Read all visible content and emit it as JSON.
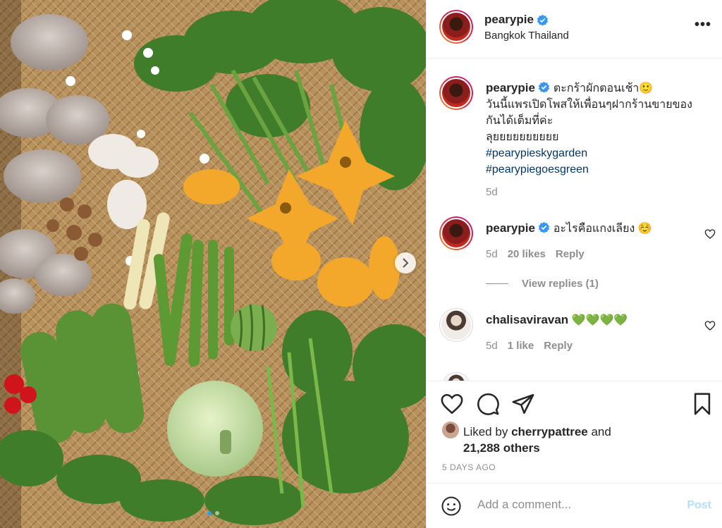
{
  "post": {
    "username": "pearypie",
    "location": "Bangkok Thailand",
    "more_label": "•••"
  },
  "caption": {
    "username": "pearypie",
    "lines": [
      "ตะกร้าผักตอนเช้า🙂",
      "วันนี้แพรเปิดโพสให้เพื่อนๆฝากร้านขายของ",
      "กันได้เต็มที่ค่ะ",
      "ลุยยยยยยยยยย"
    ],
    "hashtags": [
      "#pearypieskygarden",
      "#pearypiegoesgreen"
    ],
    "time": "5d"
  },
  "comments": [
    {
      "username": "pearypie",
      "text": "อะไรคือแกงเลียง ☺️",
      "time": "5d",
      "likes": "20 likes",
      "reply": "Reply",
      "view_replies": "View replies (1)"
    },
    {
      "username": "chalisaviravan",
      "text": "💚💚💚💚",
      "time": "5d",
      "likes": "1 like",
      "reply": "Reply"
    }
  ],
  "likes": {
    "prefix": "Liked by",
    "user": "cherrypattree",
    "and": "and",
    "others": "21,288 others"
  },
  "date_label": "5 DAYS AGO",
  "add_comment": {
    "placeholder": "Add a comment...",
    "post_label": "Post"
  },
  "icons": {
    "verified": "verified-badge-icon",
    "like": "heart-icon",
    "comment": "comment-bubble-icon",
    "share": "paper-plane-icon",
    "save": "bookmark-icon",
    "emoji": "smiley-icon",
    "next": "chevron-right-icon"
  },
  "colors": {
    "verified": "#3897f0",
    "link": "#00376b",
    "muted": "#8e8e8e",
    "post_disabled": "#b2dffc"
  }
}
